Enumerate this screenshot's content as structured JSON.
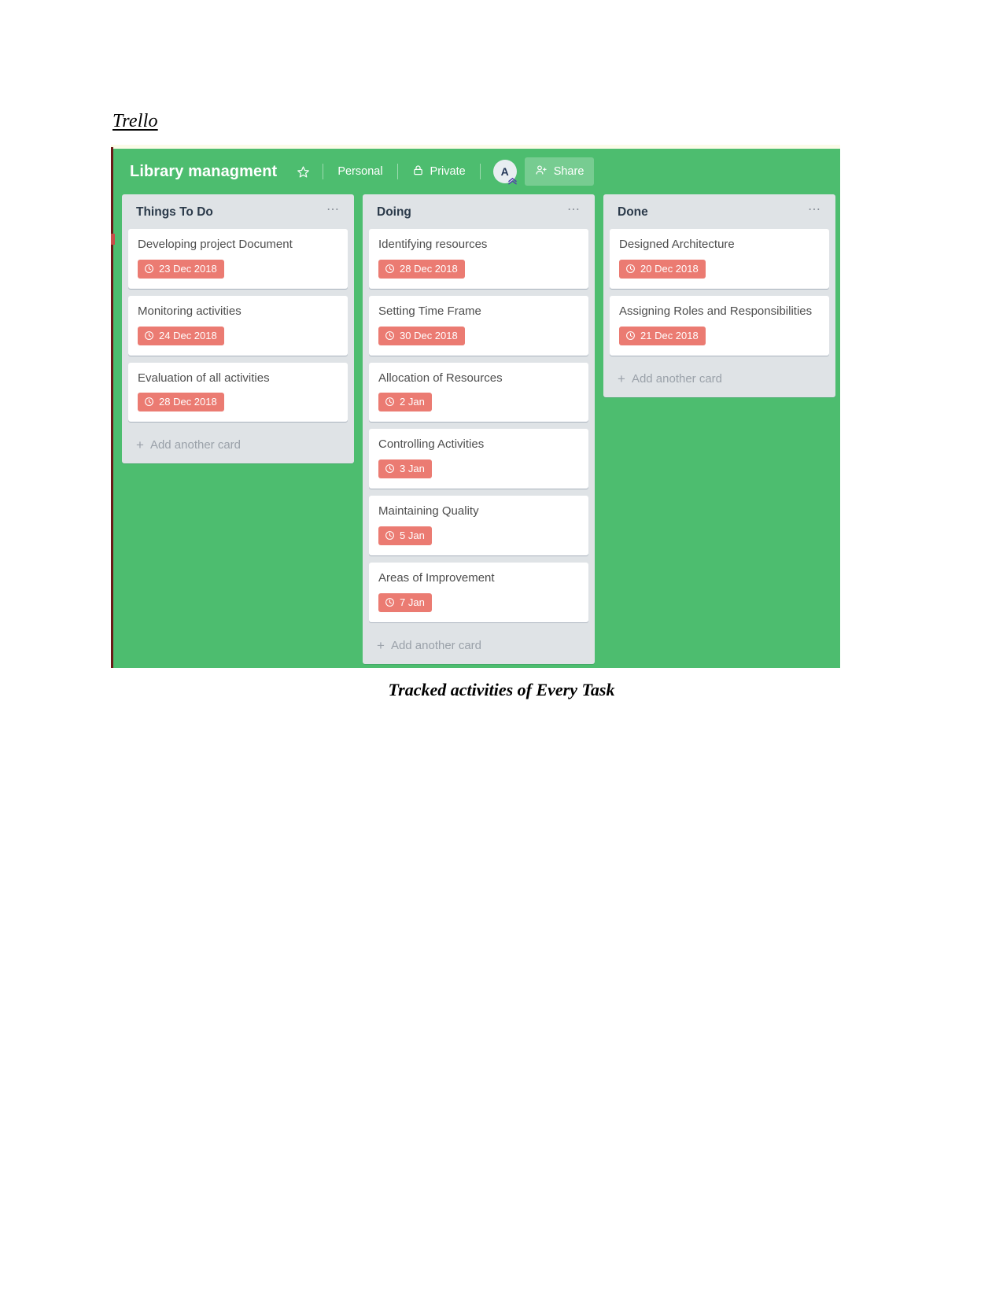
{
  "document": {
    "heading": "Trello",
    "caption": "Tracked activities of Every Task"
  },
  "colors": {
    "board_background": "#4dbd6f",
    "list_background": "#dfe3e6",
    "card_background": "#ffffff",
    "due_badge": "#eb7b72",
    "header_text": "#ffffff",
    "left_rail": "#6b1a18",
    "top_strip": "#fbfbe8"
  },
  "header": {
    "board_title": "Library managment",
    "star_icon": "star-icon",
    "visibility_group": "Personal",
    "privacy_label": "Private",
    "privacy_icon": "lock-icon",
    "avatar_initial": "A",
    "share_label": "Share",
    "share_icon": "add-member-icon"
  },
  "lists": [
    {
      "title": "Things To Do",
      "menu_icon": "list-menu-icon",
      "add_card_label": "Add another card",
      "cards": [
        {
          "title": "Developing project Document",
          "due": "23 Dec 2018",
          "due_icon": "clock-icon"
        },
        {
          "title": "Monitoring activities",
          "due": "24 Dec 2018",
          "due_icon": "clock-icon"
        },
        {
          "title": "Evaluation of all activities",
          "due": "28 Dec 2018",
          "due_icon": "clock-icon"
        }
      ]
    },
    {
      "title": "Doing",
      "menu_icon": "list-menu-icon",
      "add_card_label": "Add another card",
      "cards": [
        {
          "title": "Identifying resources",
          "due": "28 Dec 2018",
          "due_icon": "clock-icon"
        },
        {
          "title": "Setting Time Frame",
          "due": "30 Dec 2018",
          "due_icon": "clock-icon"
        },
        {
          "title": "Allocation of Resources",
          "due": "2 Jan",
          "due_icon": "clock-icon"
        },
        {
          "title": "Controlling Activities",
          "due": "3 Jan",
          "due_icon": "clock-icon"
        },
        {
          "title": "Maintaining Quality",
          "due": "5 Jan",
          "due_icon": "clock-icon"
        },
        {
          "title": "Areas of Improvement",
          "due": "7 Jan",
          "due_icon": "clock-icon"
        }
      ]
    },
    {
      "title": "Done",
      "menu_icon": "list-menu-icon",
      "add_card_label": "Add another card",
      "cards": [
        {
          "title": "Designed Architecture",
          "due": "20 Dec 2018",
          "due_icon": "clock-icon"
        },
        {
          "title": "Assigning Roles and Responsibilities",
          "due": "21 Dec 2018",
          "due_icon": "clock-icon"
        }
      ]
    }
  ]
}
